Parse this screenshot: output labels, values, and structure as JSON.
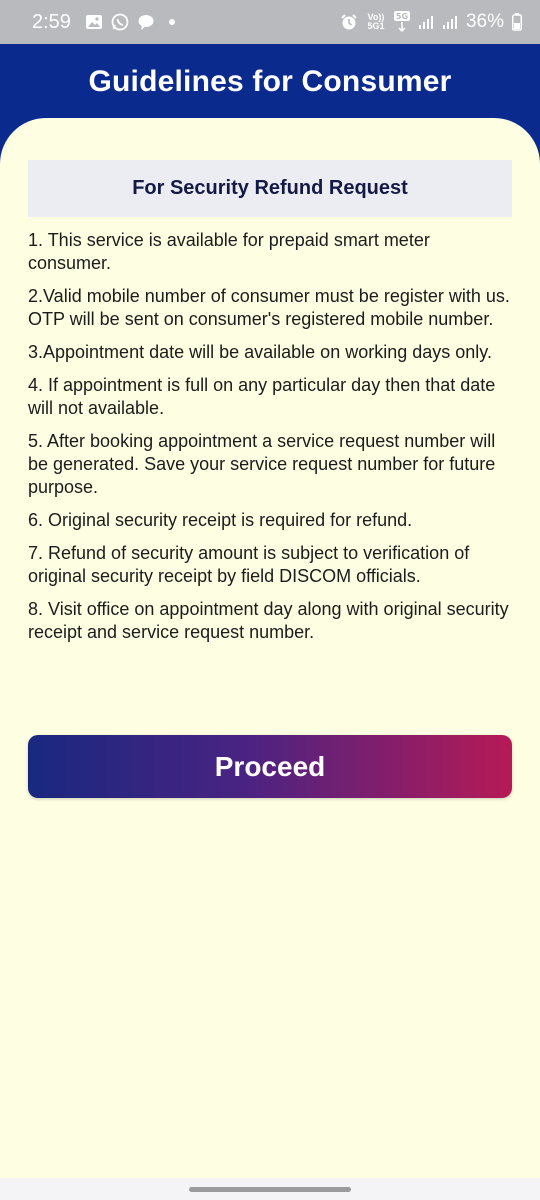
{
  "status_bar": {
    "time": "2:59",
    "battery_percent": "36%",
    "left_icons": [
      "gallery-icon",
      "whatsapp-icon",
      "chat-bubble-icon",
      "notification-dot-icon"
    ],
    "right_icons": [
      "alarm-icon",
      "volte-icon",
      "5g-icon",
      "signal-bars-icon",
      "signal-bars-icon",
      "battery-icon"
    ],
    "volte_label": "Vo)) 5G1",
    "network_label": "5G"
  },
  "header": {
    "title": "Guidelines for Consumer",
    "background_color": "#0b2a8e"
  },
  "section": {
    "title": "For Security Refund Request"
  },
  "guidelines": [
    "1. This service is available for prepaid smart meter consumer.",
    "2.Valid mobile number of consumer must be register with us. OTP will be sent on consumer's registered mobile number.",
    "3.Appointment date will be available on working days only.",
    "4. If appointment is full on any particular day then that date will not available.",
    "5. After booking appointment a service request number will be generated. Save your service request number for future purpose.",
    "6. Original security receipt is required for refund.",
    "7. Refund of security amount is subject to verification of original security receipt by field DISCOM officials.",
    "8. Visit office on appointment day along with original security receipt and service request number."
  ],
  "proceed_button": {
    "label": "Proceed",
    "gradient_start": "#19287f",
    "gradient_end": "#b61a56"
  },
  "colors": {
    "content_background": "#fefee3",
    "section_background": "#ecedf3"
  }
}
